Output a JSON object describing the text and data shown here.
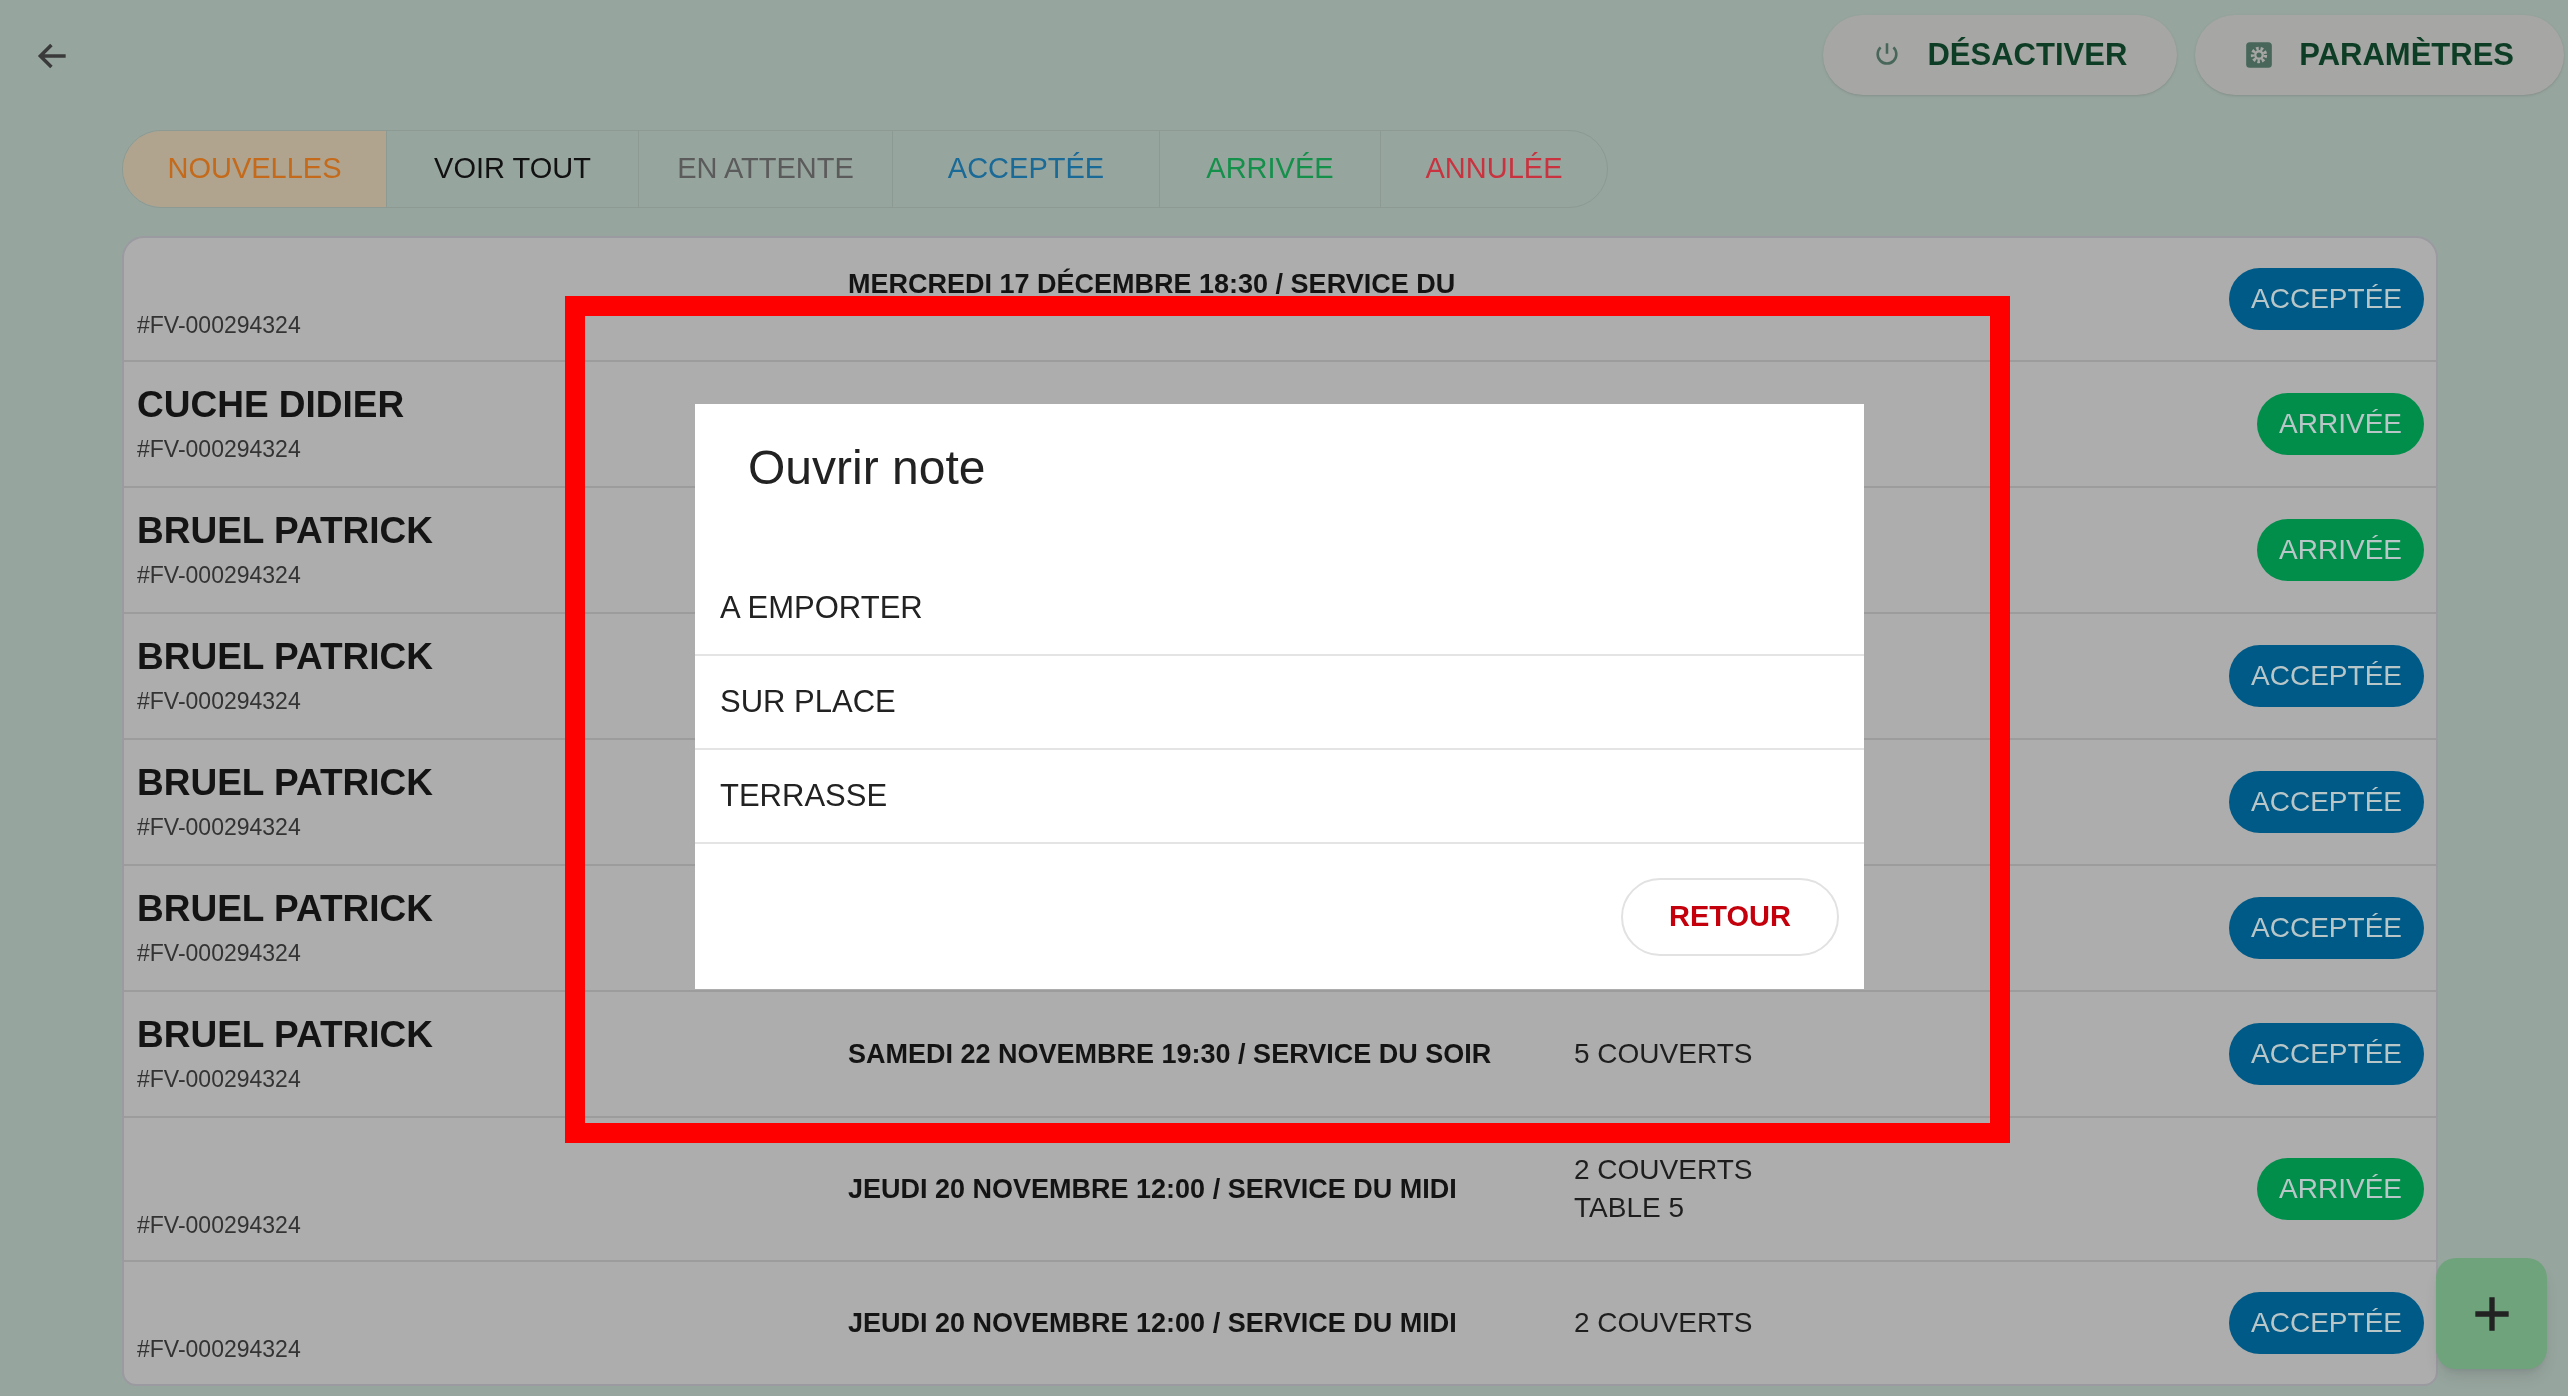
{
  "top_buttons": [
    {
      "label": "DÉSACTIVER",
      "kind": "power"
    },
    {
      "label": "PARAMÈTRES",
      "kind": "settings"
    }
  ],
  "tabs": [
    {
      "label": "NOUVELLES",
      "selected": true,
      "color": "#c46a1a"
    },
    {
      "label": "VOIR TOUT",
      "selected": false,
      "color": "#111111"
    },
    {
      "label": "EN ATTENTE",
      "selected": false,
      "color": "#5b5b5b"
    },
    {
      "label": "ACCEPTÉE",
      "selected": false,
      "color": "#1a6a98"
    },
    {
      "label": "ARRIVÉE",
      "selected": false,
      "color": "#14904a"
    },
    {
      "label": "ANNULÉE",
      "selected": false,
      "color": "#c8333f"
    }
  ],
  "reservations": [
    {
      "ref": "#FV-000294324",
      "date": "MERCREDI 17 DÉCEMBRE 18:30 / SERVICE DU",
      "status": "ACCEPTÉE",
      "kind": "accepted"
    },
    {
      "name": "CUCHE DIDIER",
      "ref": "#FV-000294324",
      "status": "ARRIVÉE",
      "kind": "arrived"
    },
    {
      "name": "BRUEL PATRICK",
      "ref": "#FV-000294324",
      "status": "ARRIVÉE",
      "kind": "arrived"
    },
    {
      "name": "BRUEL PATRICK",
      "ref": "#FV-000294324",
      "status": "ACCEPTÉE",
      "kind": "accepted"
    },
    {
      "name": "BRUEL PATRICK",
      "ref": "#FV-000294324",
      "status": "ACCEPTÉE",
      "kind": "accepted"
    },
    {
      "name": "BRUEL PATRICK",
      "ref": "#FV-000294324",
      "status": "ACCEPTÉE",
      "kind": "accepted"
    },
    {
      "name": "BRUEL PATRICK",
      "ref": "#FV-000294324",
      "date": "SAMEDI 22 NOVEMBRE 19:30 / SERVICE DU SOIR",
      "covers": [
        "5 COUVERTS"
      ],
      "status": "ACCEPTÉE",
      "kind": "accepted"
    },
    {
      "ref": "#FV-000294324",
      "date": "JEUDI 20 NOVEMBRE 12:00 / SERVICE DU MIDI",
      "covers": [
        "2 COUVERTS",
        "TABLE 5"
      ],
      "status": "ARRIVÉE",
      "kind": "arrived"
    },
    {
      "ref": "#FV-000294324",
      "date": "JEUDI 20 NOVEMBRE 12:00 / SERVICE DU MIDI",
      "covers": [
        "2 COUVERTS"
      ],
      "status": "ACCEPTÉE",
      "kind": "accepted"
    }
  ],
  "dialog": {
    "title": "Ouvrir note",
    "options": [
      "A EMPORTER",
      "SUR PLACE",
      "TERRASSE"
    ],
    "button": "RETOUR"
  },
  "highlight_frame": true
}
